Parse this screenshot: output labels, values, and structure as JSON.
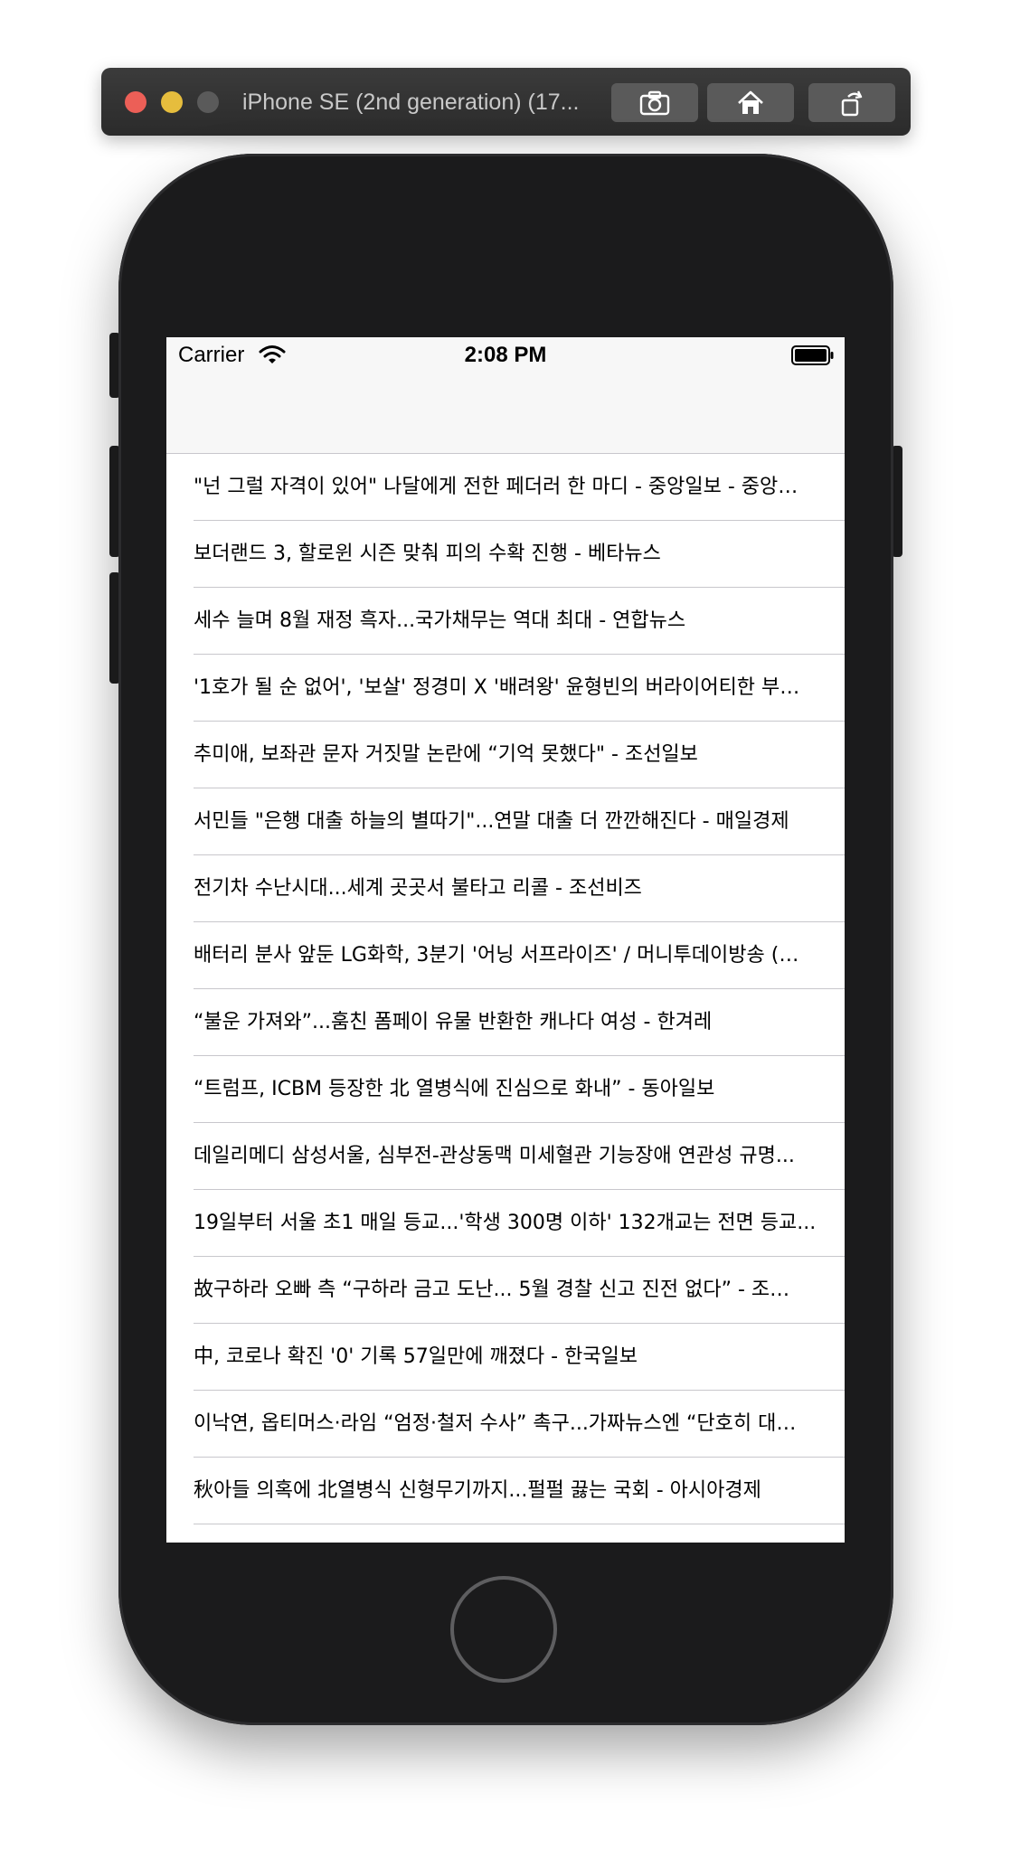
{
  "simulator": {
    "title": "iPhone SE (2nd generation) (17..."
  },
  "status_bar": {
    "carrier": "Carrier",
    "time": "2:08 PM"
  },
  "news": [
    {
      "title": "\"넌 그럴 자격이 있어\" 나달에게 전한 페더러 한 마디 - 중앙일보 - 중앙…"
    },
    {
      "title": "보더랜드 3, 할로윈 시즌 맞춰 피의 수확 진행 - 베타뉴스"
    },
    {
      "title": "세수 늘며 8월 재정 흑자...국가채무는 역대 최대 - 연합뉴스"
    },
    {
      "title": "'1호가 될 순 없어', '보살' 정경미 X '배려왕' 윤형빈의 버라이어티한 부…"
    },
    {
      "title": "추미애, 보좌관 문자 거짓말 논란에 “기억 못했다\" - 조선일보"
    },
    {
      "title": "서민들 \"은행 대출 하늘의 별따기\"...연말 대출 더 깐깐해진다 - 매일경제"
    },
    {
      "title": "전기차 수난시대...세계 곳곳서 불타고 리콜 - 조선비즈"
    },
    {
      "title": "배터리 분사 앞둔 LG화학, 3분기 '어닝 서프라이즈' / 머니투데이방송 (…"
    },
    {
      "title": "“불운 가져와”...훔친 폼페이 유물 반환한 캐나다 여성 - 한겨레"
    },
    {
      "title": "“트럼프, ICBM 등장한 北 열병식에 진심으로 화내” - 동아일보"
    },
    {
      "title": "데일리메디 삼성서울, 심부전-관상동맥 미세혈관 기능장애 연관성 규명..."
    },
    {
      "title": "19일부터 서울 초1 매일 등교...'학생 300명 이하' 132개교는 전면 등교..."
    },
    {
      "title": "故구하라 오빠 측 “구하라 금고 도난... 5월 경찰 신고 진전 없다” - 조…"
    },
    {
      "title": "中, 코로나 확진 '0' 기록 57일만에 깨졌다 - 한국일보"
    },
    {
      "title": "이낙연, 옵티머스·라임 “엄정·철저 수사” 촉구...가짜뉴스엔 “단호히 대…"
    },
    {
      "title": "秋아들 의혹에 北열병식 신형무기까지...펄펄 끓는 국회 - 아시아경제"
    }
  ]
}
